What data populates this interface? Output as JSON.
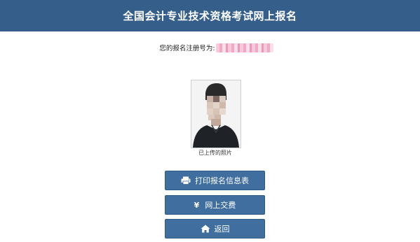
{
  "header": {
    "title": "全国会计专业技术资格考试网上报名"
  },
  "registration": {
    "label": "您的报名注册号为:",
    "value_redacted": true
  },
  "photo": {
    "caption": "已上传的照片"
  },
  "actions": {
    "print_label": "打印报名信息表",
    "print_icon": "printer-icon",
    "pay_label": "网上交费",
    "pay_icon_glyph": "¥",
    "back_label": "返回",
    "back_icon": "home-icon"
  },
  "colors": {
    "header_bg": "#355f8a",
    "button_bg": "#3f6e9f",
    "redaction": "#ef9fc0"
  }
}
